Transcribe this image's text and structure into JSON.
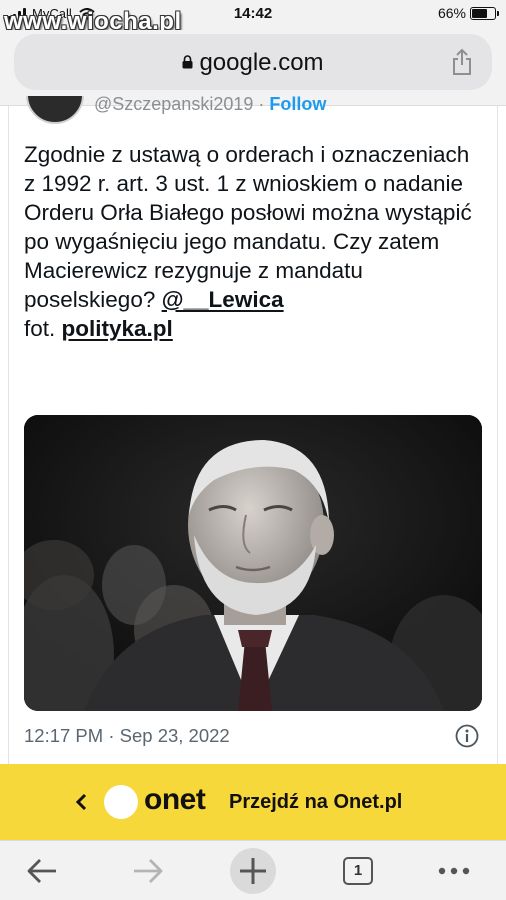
{
  "status_bar": {
    "carrier": "MyCall",
    "time": "14:42",
    "battery": "66%",
    "battery_level": 0.66
  },
  "watermark": "www.wiocha.pl",
  "browser": {
    "domain": "google.com"
  },
  "tweet": {
    "handle": "@Szczepanski2019",
    "follow_label": "Follow",
    "text_main": "Zgodnie z ustawą o orderach i oznaczeniach z 1992 r. art. 3 ust. 1 z wnioskiem o nadanie Orderu Orła Białego posłowi można wystąpić po wygaśnięciu jego mandatu. Czy zatem Macierewicz rezygnuje z mandatu poselskiego? ",
    "mention": "@__Lewica",
    "photo_prefix": "fot. ",
    "photo_link": "polityka.pl",
    "time": "12:17 PM",
    "separator": "·",
    "date": "Sep 23, 2022"
  },
  "banner": {
    "logo_text": "onet",
    "cta": "Przejdź na Onet.pl",
    "color": "#f6d83a"
  },
  "toolbar": {
    "tab_count": "1"
  },
  "icons": {
    "share": "share-icon",
    "lock": "lock-icon",
    "info": "info-icon",
    "back": "back-arrow-icon",
    "forward": "forward-arrow-icon",
    "new_tab": "plus-icon",
    "tabs": "tabs-icon",
    "more": "more-icon"
  }
}
